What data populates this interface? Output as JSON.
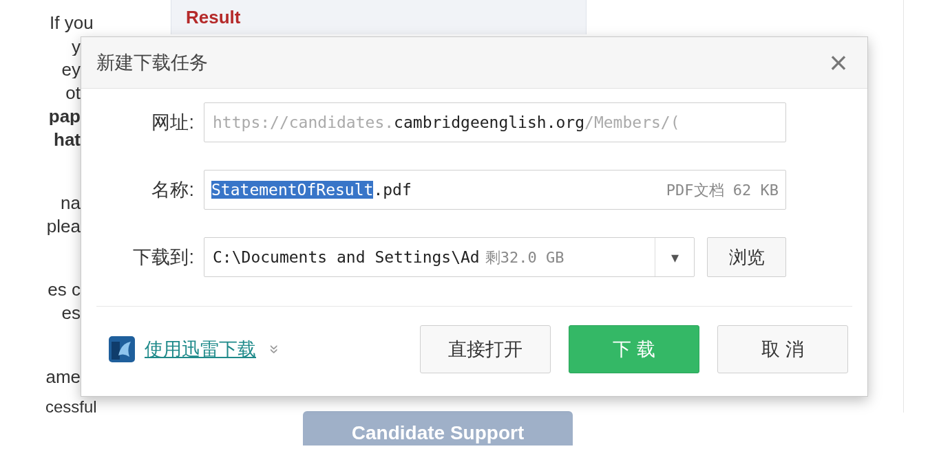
{
  "background_page": {
    "heading": "Result",
    "text_fragments": [
      "If you",
      "y",
      "ey",
      "ot",
      "pap",
      "hat",
      "na",
      "plea",
      "es c",
      "es",
      "ame",
      "cessful"
    ],
    "button": "Candidate Support"
  },
  "dialog": {
    "title": "新建下载任务",
    "close": "×",
    "url": {
      "label": "网址:",
      "value": "https://candidates.**cambridgeenglish.org**/Members/("
    },
    "name": {
      "label": "名称:",
      "selected_text": "StatementOfResult",
      "rest_text": ".pdf",
      "info": "PDF文档 62 KB"
    },
    "save_to": {
      "label": "下载到:",
      "value": "C:\\Documents and Settings\\Ad",
      "free_space": "剩32.0 GB",
      "dropdown": "▾",
      "browse": "浏览"
    },
    "thunder_link": "使用迅雷下载",
    "expand": "»",
    "buttons": [
      {
        "label": "直接打开",
        "kind": "default"
      },
      {
        "label": "下 载",
        "kind": "primary"
      },
      {
        "label": "取 消",
        "kind": "default"
      }
    ]
  }
}
